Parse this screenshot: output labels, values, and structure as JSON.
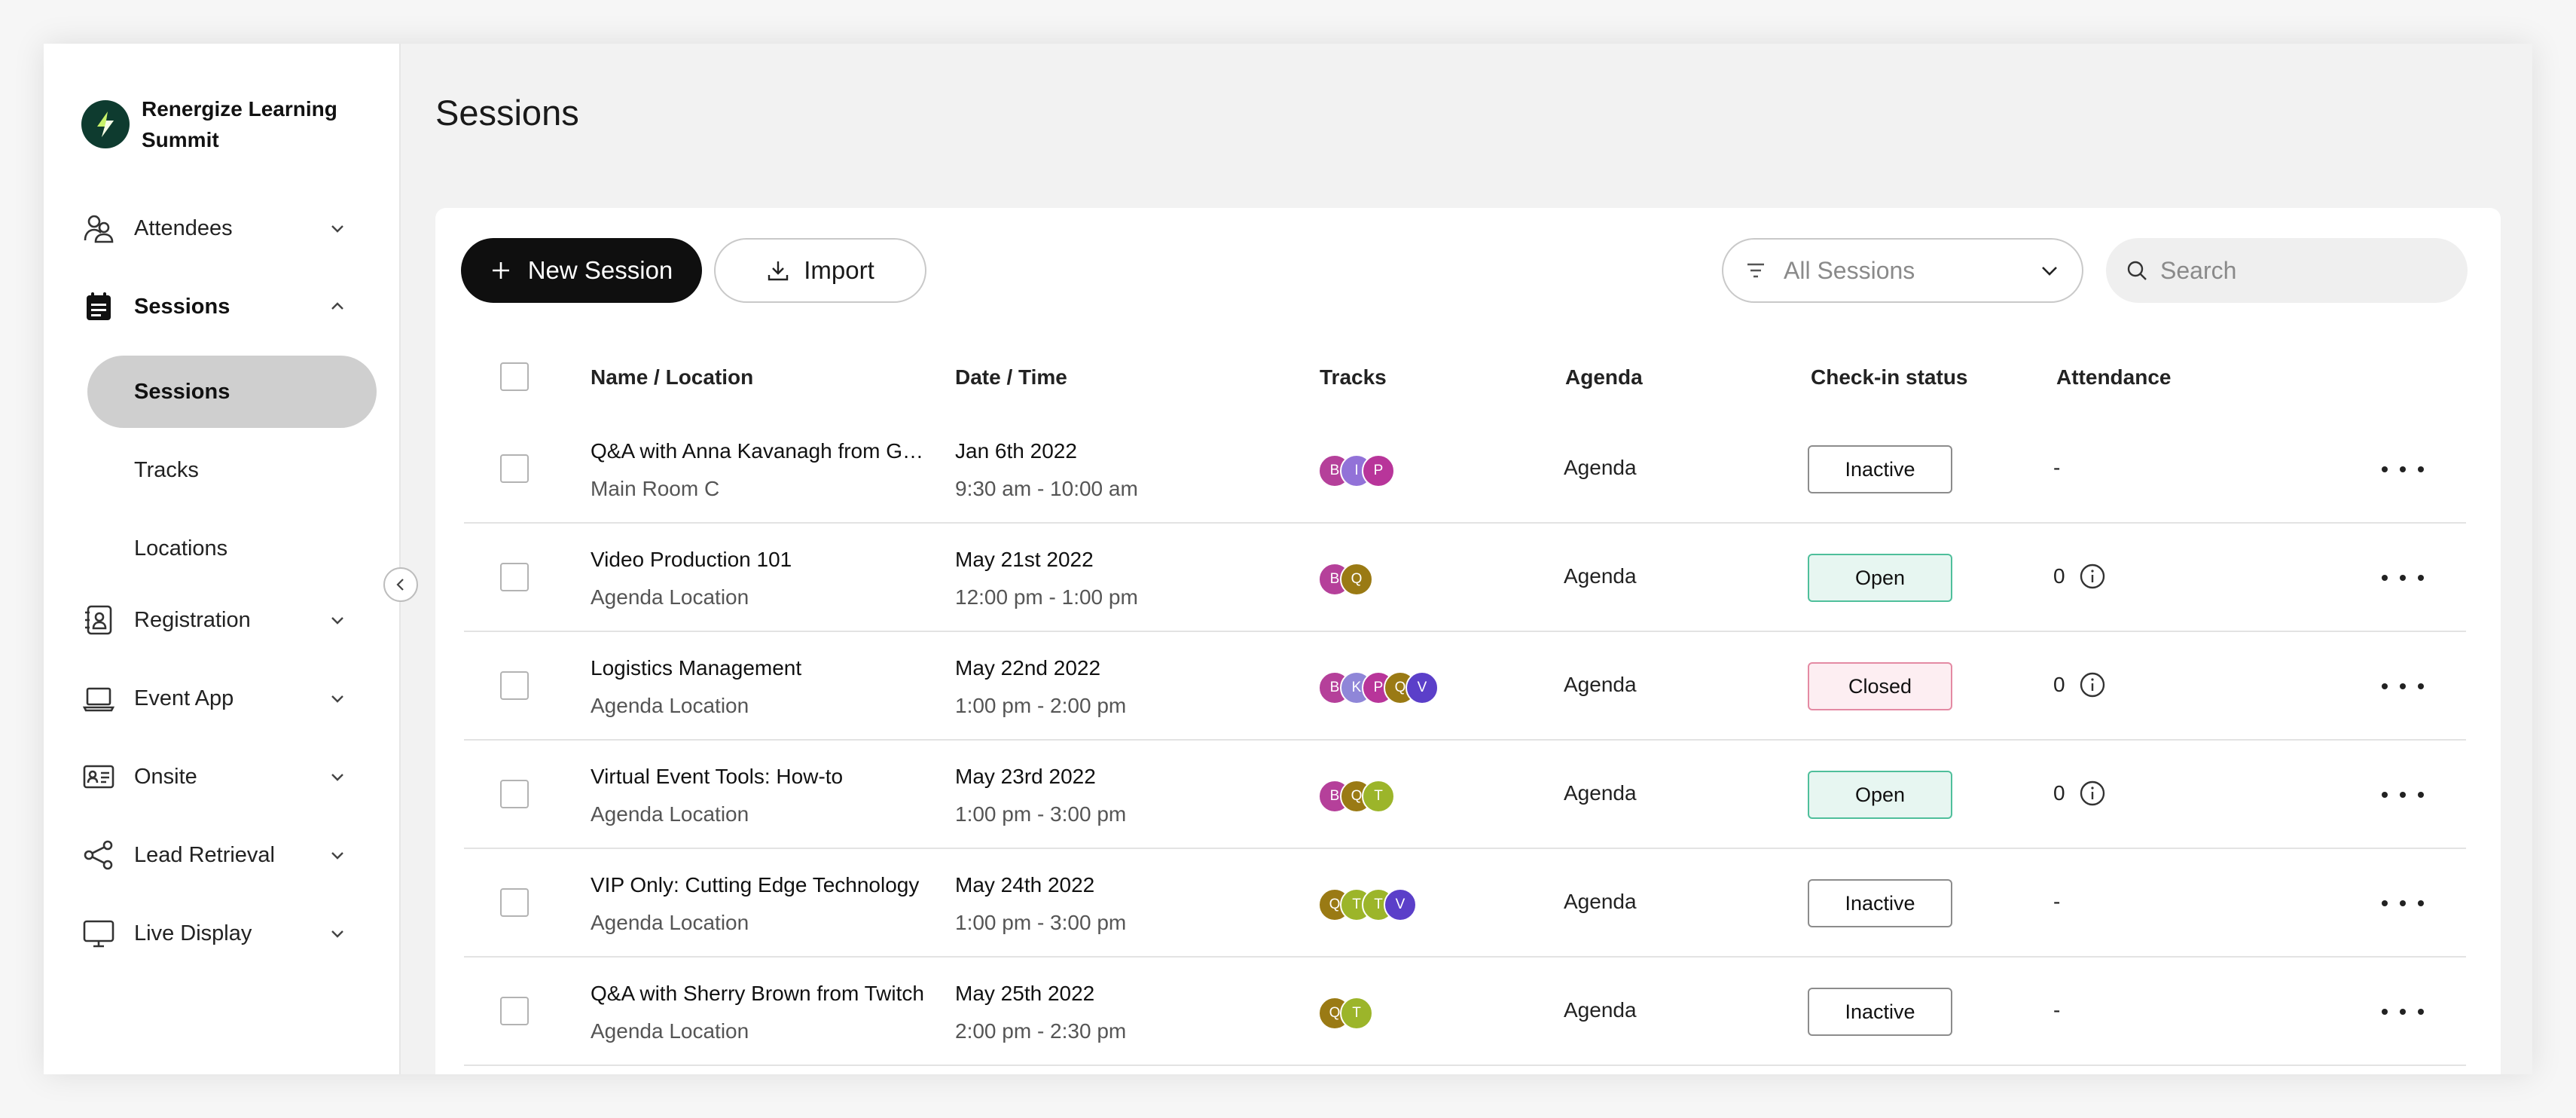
{
  "brand": {
    "name": "Renergize Learning Summit",
    "logo_color": "#0e3b2f"
  },
  "sidebar": {
    "items": [
      {
        "label": "Attendees",
        "icon": "attendees-icon",
        "expanded": false
      },
      {
        "label": "Sessions",
        "icon": "calendar-icon",
        "expanded": true,
        "active": true
      },
      {
        "label": "Registration",
        "icon": "registration-icon",
        "expanded": false
      },
      {
        "label": "Event App",
        "icon": "laptop-icon",
        "expanded": false
      },
      {
        "label": "Onsite",
        "icon": "badge-icon",
        "expanded": false
      },
      {
        "label": "Lead Retrieval",
        "icon": "share-icon",
        "expanded": false
      },
      {
        "label": "Live Display",
        "icon": "monitor-icon",
        "expanded": false
      }
    ],
    "sessions_sub": [
      {
        "label": "Sessions",
        "active": true
      },
      {
        "label": "Tracks",
        "active": false
      },
      {
        "label": "Locations",
        "active": false
      }
    ]
  },
  "page": {
    "title": "Sessions"
  },
  "toolbar": {
    "new_session_label": "New Session",
    "import_label": "Import",
    "filter_label": "All Sessions",
    "search_placeholder": "Search"
  },
  "table": {
    "headers": {
      "name": "Name / Location",
      "date": "Date / Time",
      "tracks": "Tracks",
      "agenda": "Agenda",
      "checkin": "Check-in status",
      "attendance": "Attendance"
    },
    "rows": [
      {
        "name": "Q&A with Anna Kavanagh from Go...",
        "location": "Main Room C",
        "date": "Jan 6th 2022",
        "time": "9:30 am - 10:00 am",
        "tracks": [
          "B",
          "I",
          "P"
        ],
        "agenda": "Agenda",
        "status": "Inactive",
        "attendance": "-",
        "attendance_info": false
      },
      {
        "name": "Video Production 101",
        "location": "Agenda Location",
        "date": "May 21st 2022",
        "time": "12:00 pm - 1:00 pm",
        "tracks": [
          "B",
          "Q"
        ],
        "agenda": "Agenda",
        "status": "Open",
        "attendance": "0",
        "attendance_info": true
      },
      {
        "name": "Logistics Management",
        "location": "Agenda Location",
        "date": "May 22nd 2022",
        "time": "1:00 pm - 2:00 pm",
        "tracks": [
          "B",
          "K",
          "P",
          "Q",
          "V"
        ],
        "agenda": "Agenda",
        "status": "Closed",
        "attendance": "0",
        "attendance_info": true
      },
      {
        "name": "Virtual Event Tools: How-to",
        "location": "Agenda Location",
        "date": "May 23rd 2022",
        "time": "1:00 pm - 3:00 pm",
        "tracks": [
          "B",
          "Q",
          "T"
        ],
        "agenda": "Agenda",
        "status": "Open",
        "attendance": "0",
        "attendance_info": true
      },
      {
        "name": "VIP Only: Cutting Edge Technology",
        "location": "Agenda Location",
        "date": "May 24th 2022",
        "time": "1:00 pm - 3:00 pm",
        "tracks": [
          "Q",
          "T",
          "T",
          "V"
        ],
        "agenda": "Agenda",
        "status": "Inactive",
        "attendance": "-",
        "attendance_info": false
      },
      {
        "name": "Q&A with Sherry Brown from Twitch",
        "location": "Agenda Location",
        "date": "May 25th 2022",
        "time": "2:00 pm - 2:30 pm",
        "tracks": [
          "Q",
          "T"
        ],
        "agenda": "Agenda",
        "status": "Inactive",
        "attendance": "-",
        "attendance_info": false
      }
    ]
  },
  "track_colors": {
    "B": "#b5409a",
    "I": "#9272d8",
    "K": "#8f86d8",
    "P": "#b8359a",
    "Q": "#9a7a14",
    "T": "#9cb52a",
    "V": "#5b3fc9"
  },
  "colors": {
    "primary_button": "#0f0f0f",
    "status_open_bg": "#e7f6f1",
    "status_open_border": "#4fbf9b",
    "status_closed_bg": "#fdeef2",
    "status_closed_border": "#e48aa3"
  }
}
